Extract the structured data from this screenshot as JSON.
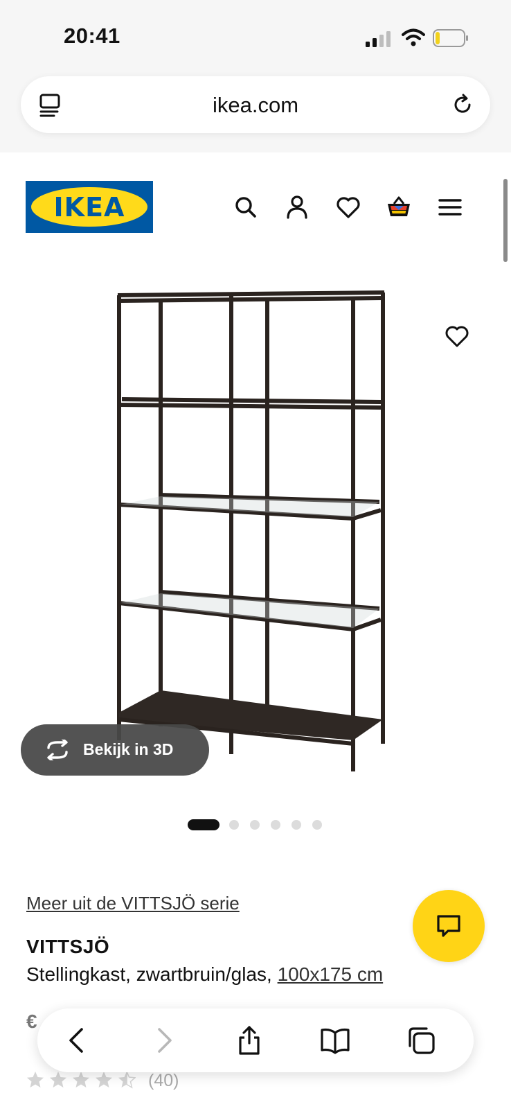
{
  "status_bar": {
    "time": "20:41"
  },
  "browser": {
    "url": "ikea.com"
  },
  "header": {
    "brand": "IKEA"
  },
  "gallery": {
    "view_3d_label": "Bekijk in 3D",
    "slide_count": 6,
    "active_slide": 1
  },
  "product": {
    "series_link": "Meer uit de VITTSJÖ serie",
    "name": "VITTSJÖ",
    "description": "Stellingkast, zwartbruin/glas,",
    "size": "100x175 cm",
    "price_partial": "€",
    "rating": {
      "stars": 4.5,
      "max": 5,
      "count_label": "(40)"
    }
  },
  "colors": {
    "ikea_blue": "#0058a3",
    "ikea_yellow": "#ffda1a",
    "chat_yellow": "#ffd416"
  }
}
